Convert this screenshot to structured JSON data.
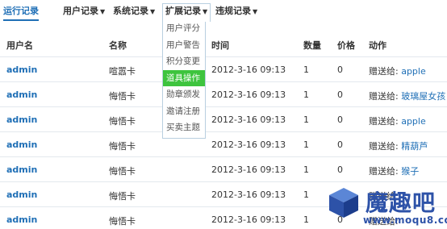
{
  "nav": {
    "active": "运行记录",
    "menus": [
      "用户记录",
      "系统记录",
      "扩展记录",
      "违规记录"
    ]
  },
  "dropdown": {
    "items": [
      "用户评分",
      "用户警告",
      "积分变更",
      "道具操作",
      "勋章颁发",
      "邀请注册",
      "买卖主题"
    ],
    "highlighted": "道具操作"
  },
  "table": {
    "headers": [
      "用户名",
      "名称",
      "时间",
      "数量",
      "价格",
      "动作"
    ],
    "rows": [
      {
        "user": "admin",
        "name": "喧嚣卡",
        "time": "2012-3-16 09:13",
        "qty": "1",
        "price": "0",
        "action": "赠送给: ",
        "target": "apple"
      },
      {
        "user": "admin",
        "name": "悔悟卡",
        "time": "2012-3-16 09:13",
        "qty": "1",
        "price": "0",
        "action": "赠送给: ",
        "target": "玻璃屋女孩"
      },
      {
        "user": "admin",
        "name": "悔悟卡",
        "time": "2012-3-16 09:13",
        "qty": "1",
        "price": "0",
        "action": "赠送给: ",
        "target": "apple"
      },
      {
        "user": "admin",
        "name": "悔悟卡",
        "time": "2012-3-16 09:13",
        "qty": "1",
        "price": "0",
        "action": "赠送给: ",
        "target": "精葫芦"
      },
      {
        "user": "admin",
        "name": "悔悟卡",
        "time": "2012-3-16 09:13",
        "qty": "1",
        "price": "0",
        "action": "赠送给: ",
        "target": "猴子"
      },
      {
        "user": "admin",
        "name": "悔悟卡",
        "time": "2012-3-16 09:13",
        "qty": "1",
        "price": "0",
        "action": "赠送给: ",
        "target": ""
      },
      {
        "user": "admin",
        "name": "悔悟卡",
        "time": "2012-3-16 09:13",
        "qty": "1",
        "price": "0",
        "action": "赠送给: ",
        "target": ""
      }
    ]
  },
  "watermark": {
    "title": "魔趣吧",
    "url": "www.moqu8.com"
  },
  "colors": {
    "link": "#1f6fb6",
    "highlight": "#3ec43e",
    "watermark": "#2d52a8"
  }
}
